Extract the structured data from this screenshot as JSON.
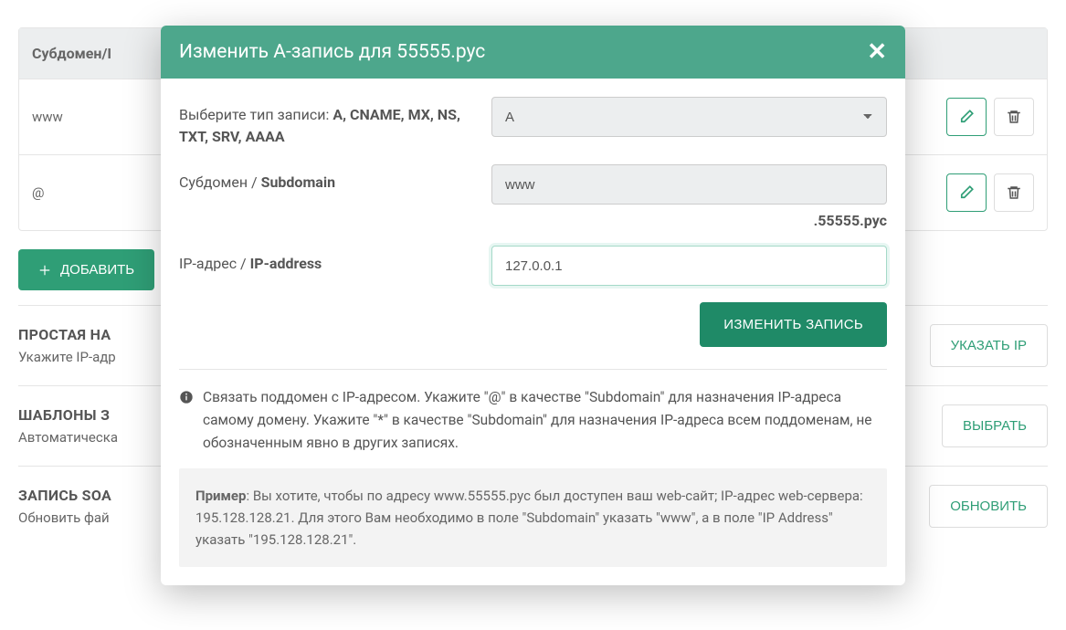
{
  "table": {
    "header": "Субдомен/I",
    "rows": [
      "www",
      "@"
    ]
  },
  "add_button": "ДОБАВИТЬ",
  "sections": {
    "simple": {
      "title": "ПРОСТАЯ НА",
      "desc": "Укажите IP-адр",
      "button": "УКАЗАТЬ IP"
    },
    "templates": {
      "title": "ШАБЛОНЫ З",
      "desc": "Автоматическа",
      "button": "ВЫБРАТЬ"
    },
    "soa": {
      "title": "ЗАПИСЬ SOA",
      "desc": "Обновить фай",
      "button": "ОБНОВИТЬ"
    }
  },
  "modal": {
    "title": "Изменить A-запись для 55555.рус",
    "record_type_label_1": "Выберите тип записи: ",
    "record_type_label_2": "A, CNAME, MX, NS, TXT, SRV, AAAA",
    "record_type_value": "A",
    "subdomain_label_1": "Субдомен / ",
    "subdomain_label_2": "Subdomain",
    "subdomain_value": "www",
    "domain_suffix": ".55555.рус",
    "ip_label_1": "IP-адрес / ",
    "ip_label_2": "IP-address",
    "ip_value": "127.0.0.1",
    "submit": "ИЗМЕНИТЬ ЗАПИСЬ",
    "info": "Связать поддомен с IP-адресом. Укажите \"@\" в качестве \"Subdomain\" для назначения IP-адреса самому домену. Укажите \"*\" в качестве \"Subdomain\" для назначения IP-адреса всем поддоменам, не обозначенным явно в других записях.",
    "example_label": "Пример",
    "example_text": ": Вы хотите, чтобы по адресу www.55555.рус был доступен ваш web-сайт; IP-адрес web-сервера: 195.128.128.21. Для этого Вам необходимо в поле \"Subdomain\" указать \"www\", а в поле \"IP Address\" указать \"195.128.128.21\"."
  }
}
